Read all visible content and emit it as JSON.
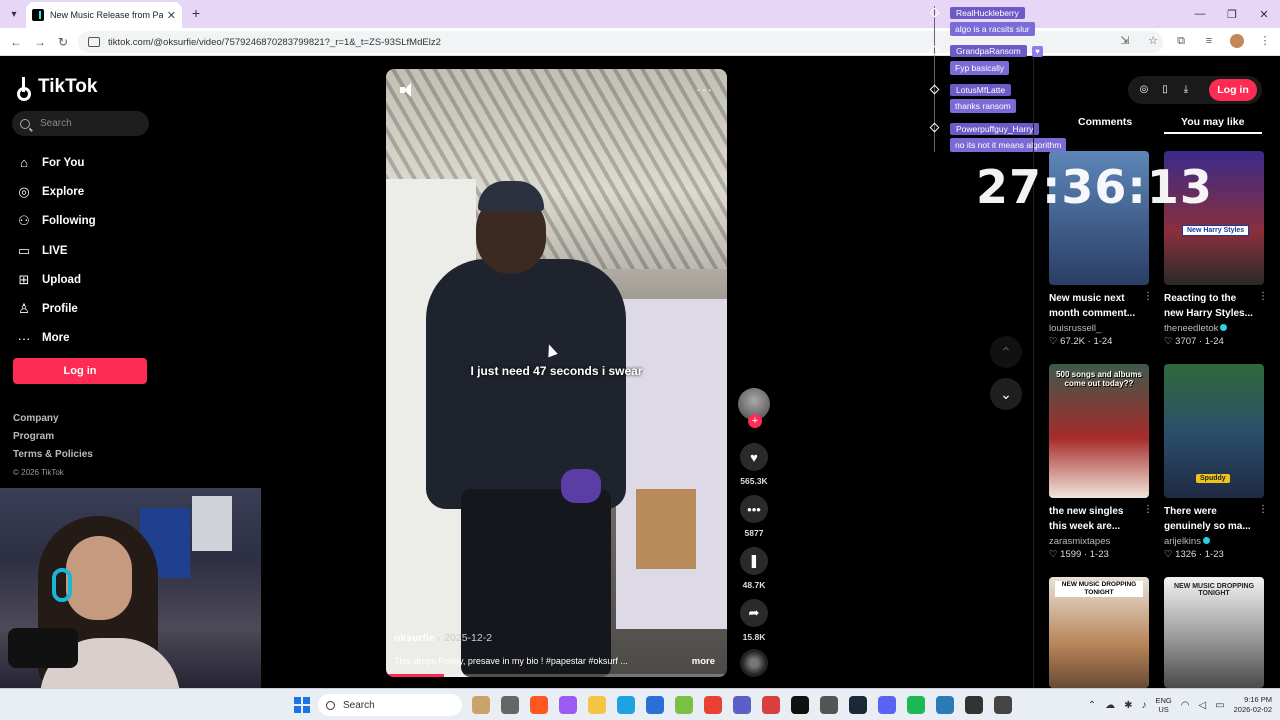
{
  "browser": {
    "tab_title": "New Music Release from Papestar",
    "tab_close": "✕",
    "new_tab": "+",
    "url": "tiktok.com/@oksurfie/video/7579246870283799821?_r=1&_t=ZS-93SLfMdElz2"
  },
  "sidebar": {
    "logo": "TikTok",
    "search_placeholder": "Search",
    "nav": [
      {
        "label": "For You",
        "icon": "home-icon"
      },
      {
        "label": "Explore",
        "icon": "compass-icon"
      },
      {
        "label": "Following",
        "icon": "following-icon"
      },
      {
        "label": "LIVE",
        "icon": "live-icon"
      },
      {
        "label": "Upload",
        "icon": "upload-icon"
      },
      {
        "label": "Profile",
        "icon": "profile-icon"
      },
      {
        "label": "More",
        "icon": "more-icon"
      }
    ],
    "login_label": "Log in",
    "footer": {
      "company": "Company",
      "program": "Program",
      "terms": "Terms & Policies",
      "copyright": "© 2026 TikTok"
    }
  },
  "video": {
    "caption": "I just need 47 seconds i swear",
    "author": "oksurfie",
    "date": "2025-12-2",
    "description": "This drops Friday, presave in my bio ! #papestar #oksurf ...",
    "more_label": "more",
    "progress_fraction": 0.17
  },
  "actions": {
    "likes": "565.3K",
    "comments": "5877",
    "saves": "48.7K",
    "shares": "15.8K"
  },
  "chat": [
    {
      "name": "RealHuckleberry",
      "message": "algo is a racsits slur"
    },
    {
      "name": "GrandpaRansom",
      "message": "Fyp basically"
    },
    {
      "name": "LotusMfLatte",
      "message": "thanks ransom"
    },
    {
      "name": "Powerpuffguy_Harry",
      "message": "no its not it means algorithm"
    }
  ],
  "timer": "27:36:13",
  "right_panel": {
    "login_label": "Log in",
    "tab_comments": "Comments",
    "tab_you_may_like": "You may like",
    "cards": [
      {
        "title": "New music next month comment...",
        "author": "louisrussell_",
        "verified": false,
        "likes": "67.2K",
        "date": "1-24",
        "thumb_color": "#4a73a8"
      },
      {
        "title": "Reacting to the new Harry Styles...",
        "author": "theneedletok",
        "verified": true,
        "likes": "3707",
        "date": "1-24",
        "thumb_color": "#8a2f3c",
        "badge": "New Harry Styles"
      },
      {
        "title": "the new singles this week are...",
        "author": "zarasmixtapes",
        "verified": false,
        "likes": "1599",
        "date": "1-23",
        "thumb_color": "#a62b2b",
        "overlay": "500 songs and albums come out today??"
      },
      {
        "title": "There were genuinely so ma...",
        "author": "arijelkins",
        "verified": true,
        "likes": "1326",
        "date": "1-23",
        "thumb_color": "#2c4f6a",
        "badge": "Spuddy"
      },
      {
        "title": "",
        "author": "",
        "verified": false,
        "likes": "",
        "date": "",
        "thumb_color": "#b8865a",
        "overlay": "NEW MUSIC DROPPING TONIGHT"
      },
      {
        "title": "",
        "author": "",
        "verified": false,
        "likes": "",
        "date": "",
        "thumb_color": "#6a6a6a",
        "overlay": "NEW MUSIC DROPPING TONIGHT"
      }
    ]
  },
  "taskbar": {
    "search_label": "Search",
    "lang_top": "ENG",
    "lang_bottom": "US",
    "time": "9:16 PM",
    "date": "2026-02-02"
  }
}
